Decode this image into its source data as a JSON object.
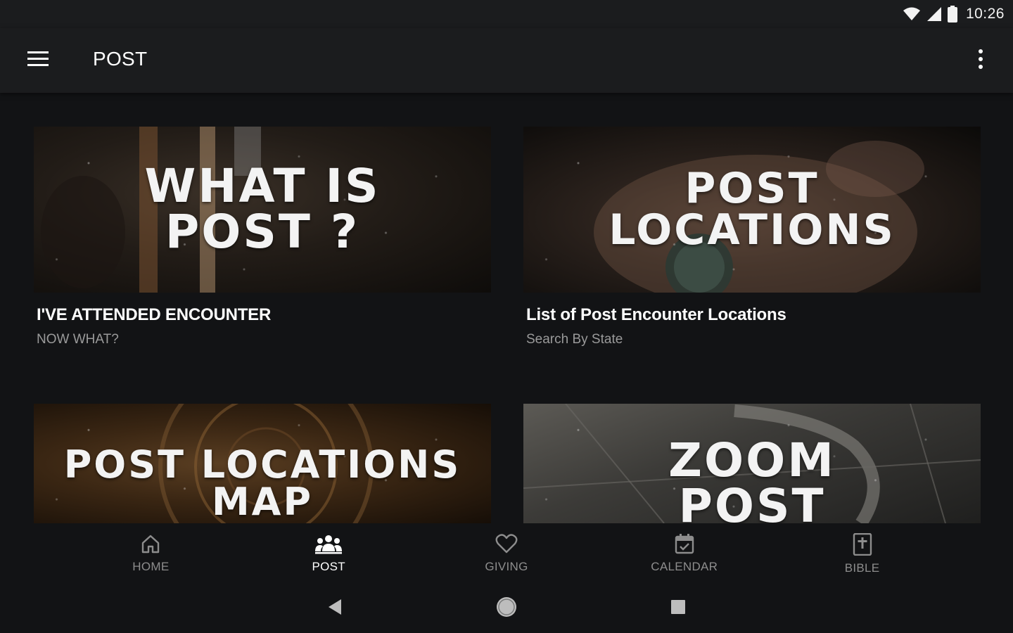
{
  "status_bar": {
    "time": "10:26",
    "icons": [
      "wifi-icon",
      "cell-signal-icon",
      "battery-icon"
    ]
  },
  "app_bar": {
    "title": "POST",
    "menu_icon": "hamburger-menu-icon",
    "overflow_icon": "more-vert-icon"
  },
  "cards": [
    {
      "image_text": "WHAT IS\nPOST ?",
      "title": "I'VE ATTENDED ENCOUNTER",
      "subtitle": "NOW WHAT?"
    },
    {
      "image_text": "POST\nLOCATIONS",
      "title": "List of Post Encounter Locations",
      "subtitle": "Search By State"
    },
    {
      "image_text": "POST LOCATIONS\nMAP",
      "title": "",
      "subtitle": ""
    },
    {
      "image_text": "ZOOM\nPOST",
      "title": "",
      "subtitle": ""
    }
  ],
  "bottom_nav": {
    "active": "POST",
    "items": [
      {
        "label": "HOME",
        "icon": "home-icon"
      },
      {
        "label": "POST",
        "icon": "group-icon"
      },
      {
        "label": "GIVING",
        "icon": "heart-icon"
      },
      {
        "label": "CALENDAR",
        "icon": "calendar-icon"
      },
      {
        "label": "BIBLE",
        "icon": "bible-icon"
      }
    ]
  },
  "system_nav": [
    "back-icon",
    "home-circle-icon",
    "recents-icon"
  ],
  "colors": {
    "background": "#121315",
    "app_bar": "#1b1c1e",
    "text_primary": "#ffffff",
    "text_secondary": "#9a9a9a",
    "nav_inactive": "#8d8d8d"
  }
}
